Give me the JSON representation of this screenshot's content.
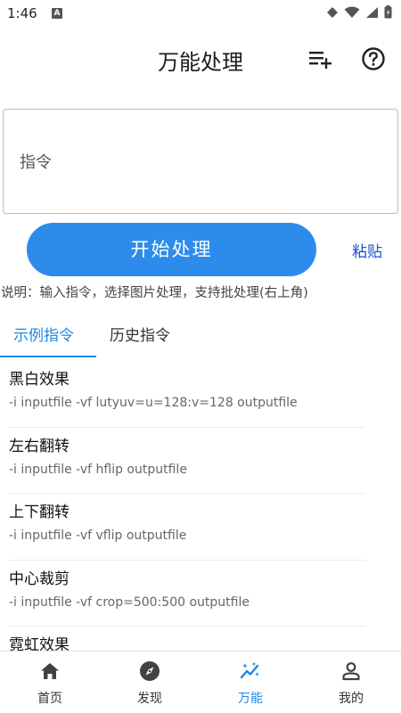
{
  "status_bar": {
    "time": "1:46",
    "notification_badge": "A"
  },
  "header": {
    "title": "万能处理",
    "add_icon": "playlist-add-icon",
    "help_icon": "help-circle-icon"
  },
  "command": {
    "placeholder": "指令",
    "value": ""
  },
  "actions": {
    "start_label": "开始处理",
    "paste_label": "粘贴"
  },
  "hint": "说明：输入指令，选择图片处理，支持批处理(右上角)",
  "tabs": [
    {
      "label": "示例指令",
      "active": true
    },
    {
      "label": "历史指令",
      "active": false
    }
  ],
  "examples": [
    {
      "title": "黑白效果",
      "command": "-i inputfile -vf lutyuv=u=128:v=128 outputfile"
    },
    {
      "title": "左右翻转",
      "command": "-i inputfile -vf hflip outputfile"
    },
    {
      "title": "上下翻转",
      "command": "-i inputfile -vf vflip outputfile"
    },
    {
      "title": "中心裁剪",
      "command": "-i inputfile -vf crop=500:500 outputfile"
    },
    {
      "title": "霓虹效果",
      "command": ""
    }
  ],
  "bottom_nav": [
    {
      "label": "首页",
      "icon": "home-icon",
      "active": false
    },
    {
      "label": "发现",
      "icon": "compass-icon",
      "active": false
    },
    {
      "label": "万能",
      "icon": "magic-chart-icon",
      "active": true
    },
    {
      "label": "我的",
      "icon": "person-icon",
      "active": false
    }
  ],
  "colors": {
    "accent": "#1e88e5",
    "button": "#2d8ceb",
    "link": "#1a4fd4"
  }
}
